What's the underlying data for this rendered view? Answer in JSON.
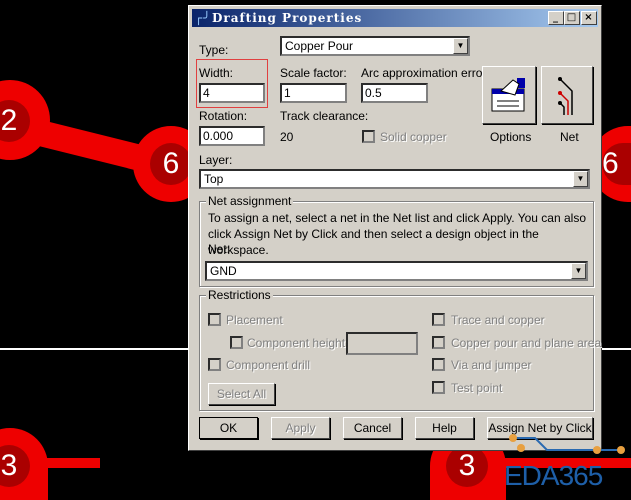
{
  "pcb": {
    "pads": [
      "2",
      "6",
      "6",
      "3",
      "3"
    ],
    "watermark": "EDA365"
  },
  "dialog": {
    "title": "Drafting Properties",
    "type_label": "Type:",
    "type_value": "Copper Pour",
    "width_label": "Width:",
    "width_value": "4",
    "scale_label": "Scale factor:",
    "scale_value": "1",
    "arc_label": "Arc approximation error:",
    "arc_value": "0.5",
    "rotation_label": "Rotation:",
    "rotation_value": "0.000",
    "clearance_label": "Track clearance:",
    "clearance_value": "20",
    "solid_copper": "Solid copper",
    "options_label": "Options",
    "net_label": "Net",
    "layer_label": "Layer:",
    "layer_value": "Top",
    "net_group": "Net assignment",
    "net_help": "To assign a net, select a net in the Net list and click Apply. You can also click Assign Net by Click and then select a design object in the workspace.",
    "net_field_label": "Net:",
    "net_value": "GND",
    "restrictions": "Restrictions",
    "placement": "Placement",
    "component_height": "Component height",
    "component_drill": "Component drill",
    "trace_copper": "Trace and copper",
    "copper_pour_plane": "Copper pour and plane area",
    "via_jumper": "Via and jumper",
    "test_point": "Test point",
    "select_all": "Select All",
    "ok": "OK",
    "apply": "Apply",
    "cancel": "Cancel",
    "help": "Help",
    "assign_net": "Assign Net by Click"
  }
}
